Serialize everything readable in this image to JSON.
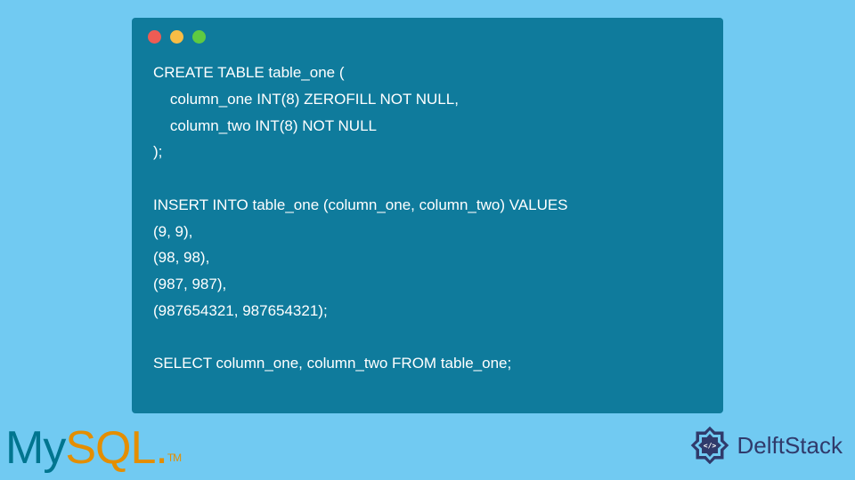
{
  "code": {
    "lines": [
      "CREATE TABLE table_one (",
      "    column_one INT(8) ZEROFILL NOT NULL,",
      "    column_two INT(8) NOT NULL",
      ");",
      "",
      "INSERT INTO table_one (column_one, column_two) VALUES",
      "(9, 9),",
      "(98, 98),",
      "(987, 987),",
      "(987654321, 987654321);",
      "",
      "SELECT column_one, column_two FROM table_one;"
    ]
  },
  "logos": {
    "mysql_my": "My",
    "mysql_sql": "SQL",
    "mysql_tm": "TM",
    "mysql_dot": ".",
    "delftstack": "DelftStack"
  }
}
